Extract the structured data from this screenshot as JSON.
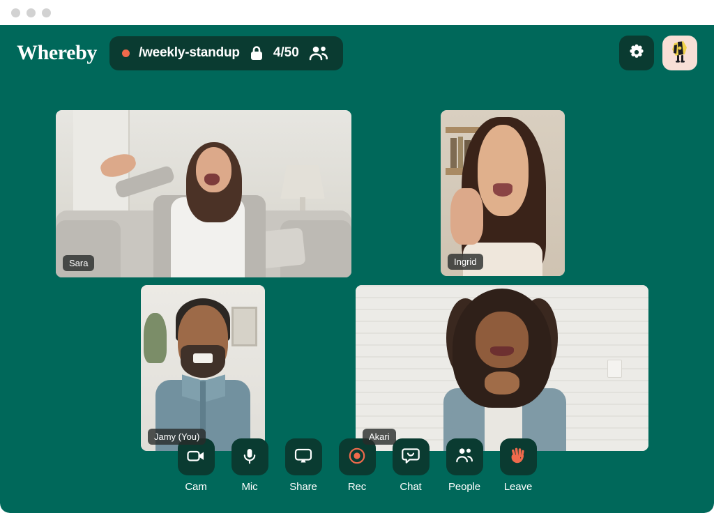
{
  "window": {
    "dots": [
      "close",
      "minimize",
      "maximize"
    ]
  },
  "colors": {
    "stage_bg": "#00685a",
    "panel_bg": "#0a3b31",
    "accent_coral": "#ef6a4c",
    "avatar_bg": "#f8dfd6",
    "text_on_dark": "#ffffff",
    "name_badge_bg": "rgba(40,44,42,0.80)"
  },
  "header": {
    "brand": "Whereby",
    "recording_dot": "recording-indicator",
    "room_name": "/weekly-standup",
    "lock_icon": "lock-icon",
    "capacity": "4/50",
    "people_icon": "people-icon",
    "settings_icon": "gear-icon",
    "avatar_icon": "user-avatar"
  },
  "participants": [
    {
      "id": "sara",
      "name": "Sara"
    },
    {
      "id": "ingrid",
      "name": "Ingrid"
    },
    {
      "id": "jamy",
      "name": "Jamy (You)"
    },
    {
      "id": "akari",
      "name": "Akari"
    }
  ],
  "toolbar": [
    {
      "id": "cam",
      "label": "Cam",
      "icon": "camera-icon"
    },
    {
      "id": "mic",
      "label": "Mic",
      "icon": "microphone-icon"
    },
    {
      "id": "share",
      "label": "Share",
      "icon": "screen-share-icon"
    },
    {
      "id": "rec",
      "label": "Rec",
      "icon": "record-icon"
    },
    {
      "id": "chat",
      "label": "Chat",
      "icon": "chat-bubble-icon"
    },
    {
      "id": "people",
      "label": "People",
      "icon": "people-icon"
    },
    {
      "id": "leave",
      "label": "Leave",
      "icon": "waving-hand-icon"
    }
  ]
}
